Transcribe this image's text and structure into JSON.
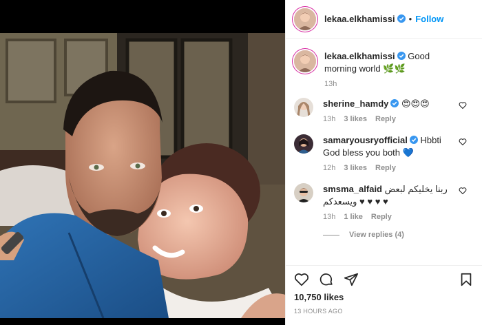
{
  "post": {
    "username": "lekaa.elkhamissi",
    "follow_label": "Follow",
    "dot": "•",
    "caption_text": "Good morning world 🌿🌿",
    "caption_time": "13h",
    "likes": "10,750 likes",
    "posted": "13 HOURS AGO"
  },
  "comments": [
    {
      "username": "sherine_hamdy",
      "text": "😍😍😍",
      "time": "13h",
      "likes": "3 likes",
      "reply": "Reply"
    },
    {
      "username": "samaryousryofficial",
      "text": "Hbbti God bless you both 💙",
      "time": "12h",
      "likes": "3 likes",
      "reply": "Reply"
    },
    {
      "username": "smsma_alfaid",
      "text": "ربنا يخليكم لبعض ويسعدكم ♥ ♥ ♥ ♥",
      "time": "13h",
      "likes": "1 like",
      "reply": "Reply"
    }
  ],
  "view_replies": "View replies (4)",
  "colors": {
    "accent": "#0095f6",
    "verified": "#3897f0",
    "muted": "#8e8e8e"
  },
  "icons": [
    "verified-icon",
    "heart-icon",
    "comment-icon",
    "share-icon",
    "bookmark-icon"
  ]
}
